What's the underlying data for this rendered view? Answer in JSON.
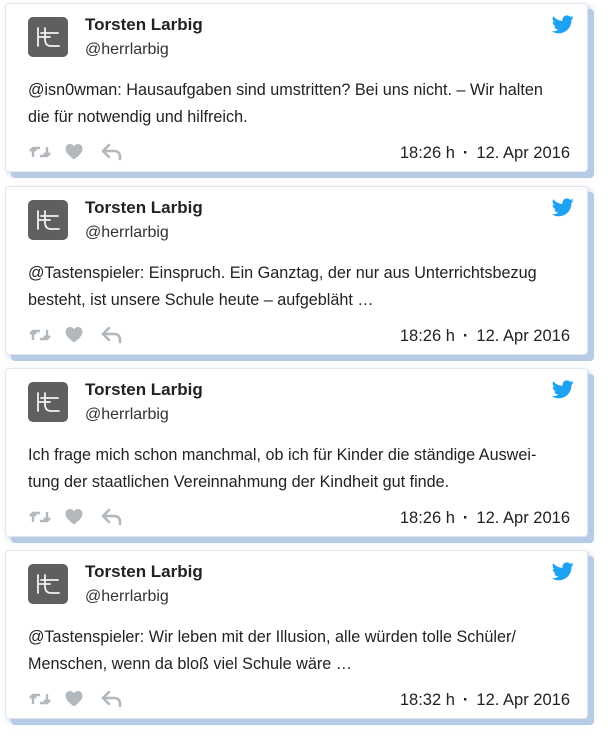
{
  "colors": {
    "twitter_blue": "#1da1f2",
    "action_grey": "#b3b8bd",
    "avatar_bg": "#5f5f5f",
    "card_shadow": "#b8cbe6"
  },
  "icons": {
    "brand": "twitter-bird-icon",
    "retweet": "retweet-icon",
    "like": "heart-icon",
    "reply": "reply-icon",
    "avatar_monogram": "Ht"
  },
  "tweets": [
    {
      "author": "Torsten Larbig",
      "handle": "@herrlarbig",
      "lines": [
        "@isn0wman: Hausaufgaben sind umstritten? Bei uns nicht. – Wir halten",
        "die für notwendig und hilfreich."
      ],
      "time": "18:26 h",
      "date": "12. Apr 2016"
    },
    {
      "author": "Torsten Larbig",
      "handle": "@herrlarbig",
      "lines": [
        "@Tastenspieler: Einspruch. Ein Ganztag, der nur aus Unterrichtsbezug",
        "besteht, ist unsere Schule heute – aufgebläht …"
      ],
      "time": "18:26 h",
      "date": "12. Apr 2016"
    },
    {
      "author": "Torsten Larbig",
      "handle": "@herrlarbig",
      "lines": [
        "Ich frage mich schon manchmal, ob ich für Kinder die ständige Auswei-",
        "tung der staatlichen Vereinnahmung der Kindheit gut finde."
      ],
      "time": "18:26 h",
      "date": "12. Apr 2016"
    },
    {
      "author": "Torsten Larbig",
      "handle": "@herrlarbig",
      "lines": [
        "@Tastenspieler: Wir leben mit der Illusion, alle würden tolle Schüler/",
        "Menschen, wenn da bloß viel Schule wäre …"
      ],
      "time": "18:32 h",
      "date": "12. Apr 2016"
    }
  ]
}
